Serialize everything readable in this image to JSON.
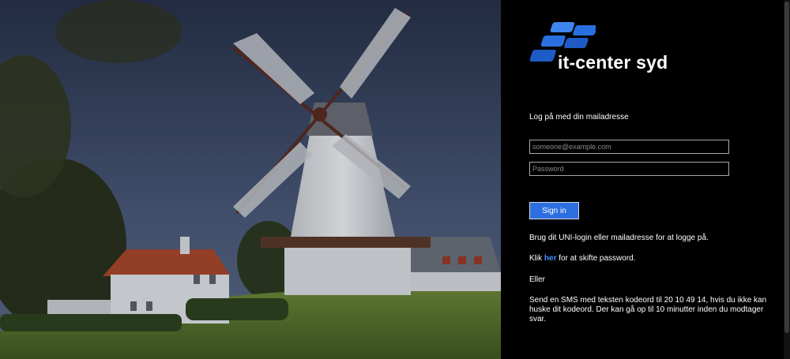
{
  "brand": {
    "name": "it-center syd",
    "logo_colors": [
      "#2a6fe0",
      "#1f5bc4",
      "#3d86f0"
    ]
  },
  "login": {
    "heading": "Log på med din mailadresse",
    "email_placeholder": "someone@example.com",
    "password_placeholder": "Password",
    "signin_label": "Sign in"
  },
  "info": {
    "unilogin": "Brug dit UNI-login eller mailadresse for at logge på.",
    "reset_prefix": "Klik ",
    "reset_link": "her",
    "reset_suffix": " for at skifte password.",
    "or": "Eller",
    "sms": "Send en SMS med teksten kodeord til 20 10 49 14, hvis du ikke kan huske dit kodeord. Der kan gå op til 10 minutter inden du modtager svar."
  },
  "colors": {
    "accent": "#2e6fe0",
    "link": "#4a90ff",
    "panel_background": "#000000"
  }
}
